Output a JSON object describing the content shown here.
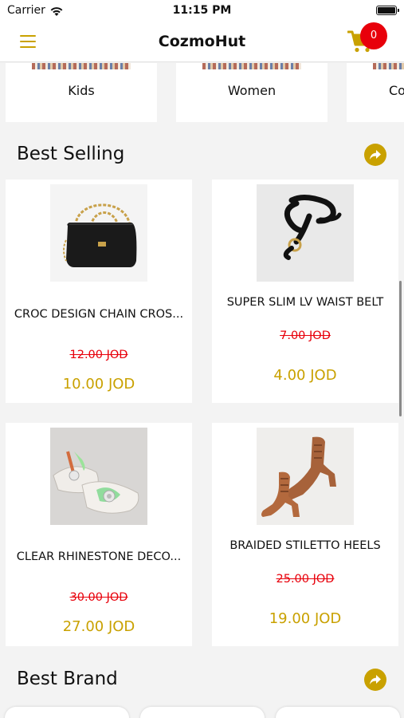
{
  "status_bar": {
    "carrier": "Carrier",
    "time": "11:15 PM"
  },
  "header": {
    "title": "CozmoHut",
    "cart_count": "0"
  },
  "categories": [
    {
      "label": "Kids"
    },
    {
      "label": "Women"
    },
    {
      "label": "Co"
    }
  ],
  "best_selling": {
    "title": "Best Selling",
    "products": [
      {
        "name": "CROC DESIGN CHAIN CROS...",
        "old_price": "12.00  JOD",
        "price": "10.00  JOD"
      },
      {
        "name": "SUPER SLIM LV WAIST BELT",
        "old_price": "7.00  JOD",
        "price": "4.00  JOD"
      },
      {
        "name": "CLEAR RHINESTONE DECO...",
        "old_price": "30.00  JOD",
        "price": "27.00  JOD"
      },
      {
        "name": "BRAIDED STILETTO HEELS",
        "old_price": "25.00  JOD",
        "price": "19.00  JOD"
      }
    ]
  },
  "best_brand": {
    "title": "Best Brand"
  },
  "colors": {
    "accent": "#c9a100",
    "sale": "#e8000b",
    "badge": "#e8000b"
  },
  "icons": {
    "menu": "hamburger-menu-icon",
    "cart": "shopping-cart-icon",
    "more": "share-arrow-icon",
    "wifi": "wifi-icon",
    "battery": "battery-icon"
  }
}
